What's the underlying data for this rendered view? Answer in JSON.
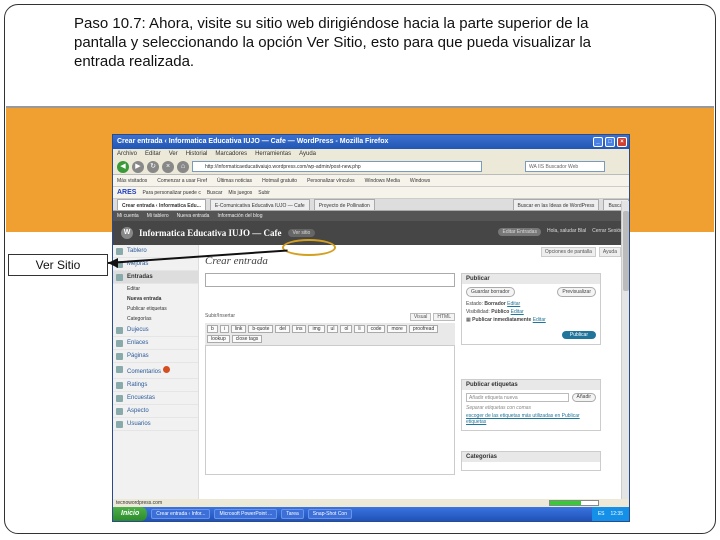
{
  "caption": "Paso 10.7: Ahora, visite su sitio web dirigiéndose hacia la parte superior de la pantalla y seleccionando la opción Ver Sitio, esto para que pueda visualizar la entrada realizada.",
  "callout_label": "Ver Sitio",
  "browser": {
    "title": "Crear entrada ‹ Informatica Educativa IUJO — Cafe — WordPress - Mozilla Firefox",
    "menu": [
      "Archivo",
      "Editar",
      "Ver",
      "Historial",
      "Marcadores",
      "Herramientas",
      "Ayuda"
    ],
    "url": "http://informaticaeducativaiujo.wordpress.com/wp-admin/post-new.php",
    "search_placeholder": "WA IIS Buscador Web",
    "bookmarks": [
      "Más visitados",
      "Comenzar a usar Firef",
      "Últimas noticias",
      "Hotmail gratuito",
      "Personalizar vínculos",
      "Windows Media",
      "Windows"
    ],
    "ares_label": "ARES",
    "toolbar2": [
      "Para personalizar puede c",
      "Buscar",
      "Mis juegos",
      "Subir"
    ],
    "tabs": [
      "Crear entrada ‹ Informatica Edu...",
      "E-Comunicativa Educativa IUJO — Cafe",
      "Proyecto de Pollination"
    ],
    "search_right": "Buscar en las Ideas de WordPress",
    "search_right_btn": "Buscar"
  },
  "wp": {
    "adminbar": [
      "Mi cuenta",
      "Mi tablero",
      "Nueva entrada",
      "Información del blog"
    ],
    "logo": "W",
    "site_title": "Informatica Educativa IUJO — Cafe",
    "ver_sitio": "Ver sitio",
    "header_right": [
      "Editar Entradas",
      "Hola, saludar Blal",
      "Cerrar Sesión"
    ],
    "screen_options": [
      "Opciones de pantalla",
      "Ayuda"
    ],
    "sidebar": [
      {
        "label": "Tablero",
        "type": "item"
      },
      {
        "label": "Mejoras",
        "type": "item"
      },
      {
        "label": "Entradas",
        "type": "head"
      },
      {
        "label": "Editar",
        "type": "sub"
      },
      {
        "label": "Nueva entrada",
        "type": "sub-bold"
      },
      {
        "label": "Publicar etiquetas",
        "type": "sub"
      },
      {
        "label": "Categorías",
        "type": "sub"
      },
      {
        "label": "Dujecus",
        "type": "item"
      },
      {
        "label": "Enlaces",
        "type": "item"
      },
      {
        "label": "Páginas",
        "type": "item"
      },
      {
        "label": "Comentarios",
        "type": "item-badge"
      },
      {
        "label": "Ratings",
        "type": "item"
      },
      {
        "label": "Encuestas",
        "type": "item"
      },
      {
        "label": "Aspecto",
        "type": "item"
      },
      {
        "label": "Usuarios",
        "type": "item"
      }
    ],
    "page_heading": "Crear entrada",
    "upload_label": "Subir/Insertar",
    "editor_tabs": [
      "Visual",
      "HTML"
    ],
    "quicktags": [
      "b",
      "i",
      "link",
      "b-quote",
      "del",
      "ins",
      "img",
      "ul",
      "ol",
      "li",
      "code",
      "more",
      "proofread",
      "lookup",
      "close tags"
    ],
    "publish": {
      "title": "Publicar",
      "save_draft": "Guardar borrador",
      "preview": "Previsualizar",
      "status_label": "Estado:",
      "status_value": "Borrador",
      "status_edit": "Editar",
      "visibility_label": "Visibilidad:",
      "visibility_value": "Público",
      "visibility_edit": "Editar",
      "publish_label": "Publicar inmediatamente",
      "publish_edit": "Editar",
      "publish_button": "Publicar"
    },
    "tags": {
      "title": "Publicar etiquetas",
      "placeholder": "Añadir etiqueta nueva",
      "add_button": "Añadir",
      "hint": "Separar etiquetas con comas",
      "link": "escoger de las etiquetas más utilizadas en Publicar etiquetas"
    },
    "categories_title": "Categorías"
  },
  "statusbar_text": "tecnowordpress.com",
  "statusbar_progress": 0.65,
  "taskbar": {
    "start": "Inicio",
    "tasks": [
      "Crear entrada ‹ Infor...",
      "Microsoft PowerPoint ...",
      "Tarea",
      "Snap-Shot Con"
    ],
    "tray": [
      "ES",
      "12:35"
    ]
  },
  "colors": {
    "band": "#f0a030",
    "oval": "#d4a020",
    "wp_blue": "#21759b"
  }
}
